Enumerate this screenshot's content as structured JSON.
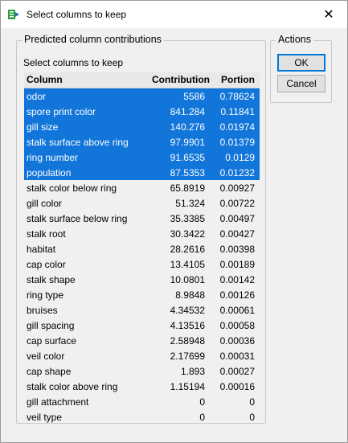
{
  "window": {
    "title": "Select columns to keep",
    "close_glyph": "✕"
  },
  "contributions": {
    "group_label": "Predicted column contributions",
    "sub_label": "Select columns to keep",
    "headers": {
      "column": "Column",
      "contribution": "Contribution",
      "portion": "Portion"
    },
    "rows": [
      {
        "column": "odor",
        "contribution": "5586",
        "portion": "0.78624",
        "selected": true
      },
      {
        "column": "spore print color",
        "contribution": "841.284",
        "portion": "0.11841",
        "selected": true
      },
      {
        "column": "gill size",
        "contribution": "140.276",
        "portion": "0.01974",
        "selected": true
      },
      {
        "column": "stalk surface above ring",
        "contribution": "97.9901",
        "portion": "0.01379",
        "selected": true
      },
      {
        "column": "ring number",
        "contribution": "91.6535",
        "portion": "0.0129",
        "selected": true
      },
      {
        "column": "population",
        "contribution": "87.5353",
        "portion": "0.01232",
        "selected": true
      },
      {
        "column": "stalk color below ring",
        "contribution": "65.8919",
        "portion": "0.00927",
        "selected": false
      },
      {
        "column": "gill color",
        "contribution": "51.324",
        "portion": "0.00722",
        "selected": false
      },
      {
        "column": "stalk surface below ring",
        "contribution": "35.3385",
        "portion": "0.00497",
        "selected": false
      },
      {
        "column": "stalk root",
        "contribution": "30.3422",
        "portion": "0.00427",
        "selected": false
      },
      {
        "column": "habitat",
        "contribution": "28.2616",
        "portion": "0.00398",
        "selected": false
      },
      {
        "column": "cap color",
        "contribution": "13.4105",
        "portion": "0.00189",
        "selected": false
      },
      {
        "column": "stalk shape",
        "contribution": "10.0801",
        "portion": "0.00142",
        "selected": false
      },
      {
        "column": "ring type",
        "contribution": "8.9848",
        "portion": "0.00126",
        "selected": false
      },
      {
        "column": "bruises",
        "contribution": "4.34532",
        "portion": "0.00061",
        "selected": false
      },
      {
        "column": "gill spacing",
        "contribution": "4.13516",
        "portion": "0.00058",
        "selected": false
      },
      {
        "column": "cap surface",
        "contribution": "2.58948",
        "portion": "0.00036",
        "selected": false
      },
      {
        "column": "veil color",
        "contribution": "2.17699",
        "portion": "0.00031",
        "selected": false
      },
      {
        "column": "cap shape",
        "contribution": "1.893",
        "portion": "0.00027",
        "selected": false
      },
      {
        "column": "stalk color above ring",
        "contribution": "1.15194",
        "portion": "0.00016",
        "selected": false
      },
      {
        "column": "gill attachment",
        "contribution": "0",
        "portion": "0",
        "selected": false
      },
      {
        "column": "veil type",
        "contribution": "0",
        "portion": "0",
        "selected": false
      }
    ]
  },
  "actions": {
    "group_label": "Actions",
    "ok_label": "OK",
    "cancel_label": "Cancel"
  },
  "colors": {
    "selection": "#1175d9",
    "icon_green": "#2e9e3a"
  }
}
